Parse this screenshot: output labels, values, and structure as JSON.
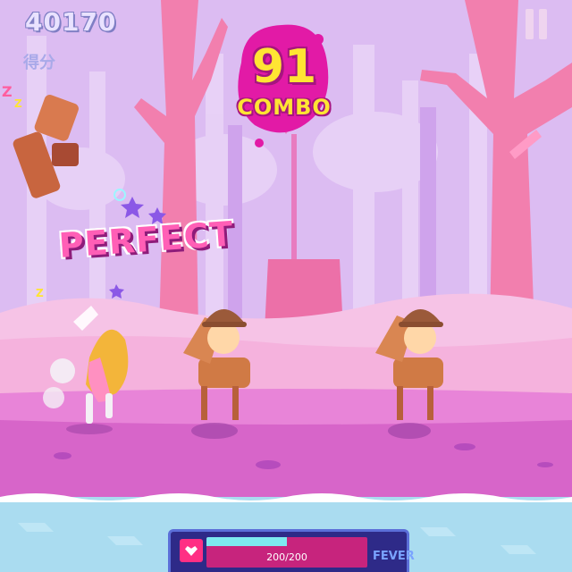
{
  "hud": {
    "score": "40170",
    "score_label": "得分",
    "combo": "91",
    "combo_label": "COMBO",
    "judgement": "PERFECT"
  },
  "fever": {
    "value_text": "200/200",
    "label": "FEVER",
    "fill_fraction": 0.5
  },
  "colors": {
    "sky": "#d8b6ee",
    "tree": "#f17fb0",
    "ground": "#e07ad8",
    "water": "#a9dcef",
    "accent": "#ffe533"
  },
  "icons": [
    "pause-icon",
    "heart-icon",
    "star-icon"
  ]
}
